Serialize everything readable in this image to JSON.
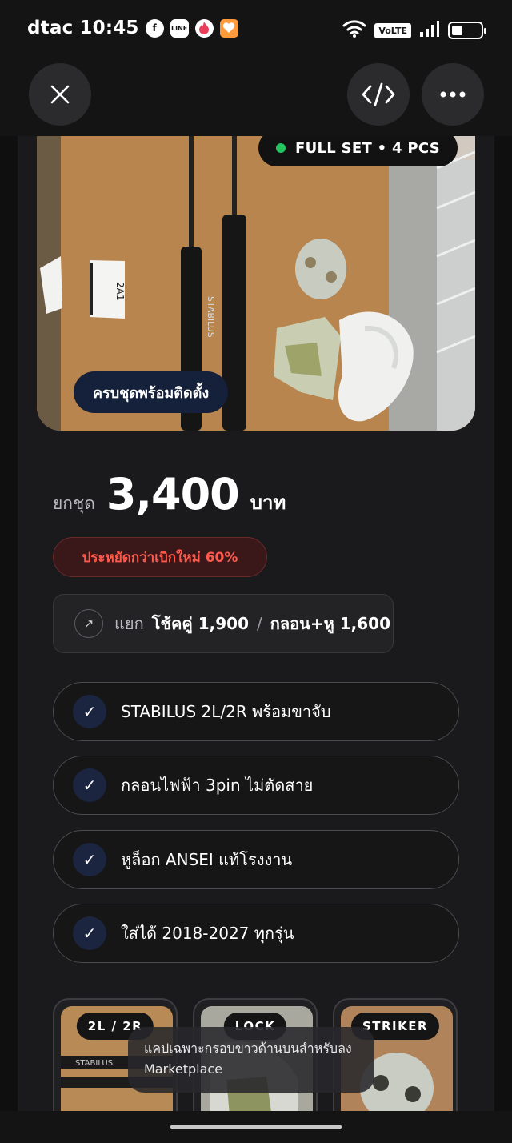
{
  "status_bar": {
    "carrier": "dtac",
    "time": "10:45",
    "apps": [
      "facebook-icon",
      "line-icon",
      "tinder-icon",
      "heart-app-icon"
    ],
    "volte": "VoLTE",
    "battery_level": 0.35
  },
  "app_bar": {
    "close_icon": "close-icon",
    "code_icon": "code-icon",
    "more_icon": "more-icon"
  },
  "hero": {
    "badge": "FULL SET • 4 PCS",
    "badge_dot_color": "#22c55e",
    "caption": "ครบชุดพร้อมติดตั้ง",
    "label_on_box": "2A1",
    "brand_on_strut": "STABILUS"
  },
  "price": {
    "prefix": "ยกชุด",
    "value": "3,400",
    "unit": "บาท"
  },
  "savings": "ประหยัดกว่าเบิกใหม่ 60%",
  "separate": {
    "label": "แยก",
    "item1": "โช้คคู่ 1,900",
    "slash": "/",
    "item2": "กลอน+หู 1,600"
  },
  "features": [
    "STABILUS 2L/2R พร้อมขาจับ",
    "กลอนไฟฟ้า 3pin ไม่ตัดสาย",
    "หูล็อก ANSEI แท้โรงงาน",
    "ใส่ได้ 2018-2027 ทุกรุ่น"
  ],
  "thumbnails": [
    {
      "tag": "2L / 2R",
      "brand": "STABILUS"
    },
    {
      "tag": "LOCK"
    },
    {
      "tag": "STRIKER"
    }
  ],
  "toast": "แคปเฉพาะกรอบขาวด้านบนสำหรับลง Marketplace",
  "colors": {
    "accent_green": "#22c55e",
    "savings_red": "#ff5a4e",
    "navy_chip": "#15203a"
  }
}
